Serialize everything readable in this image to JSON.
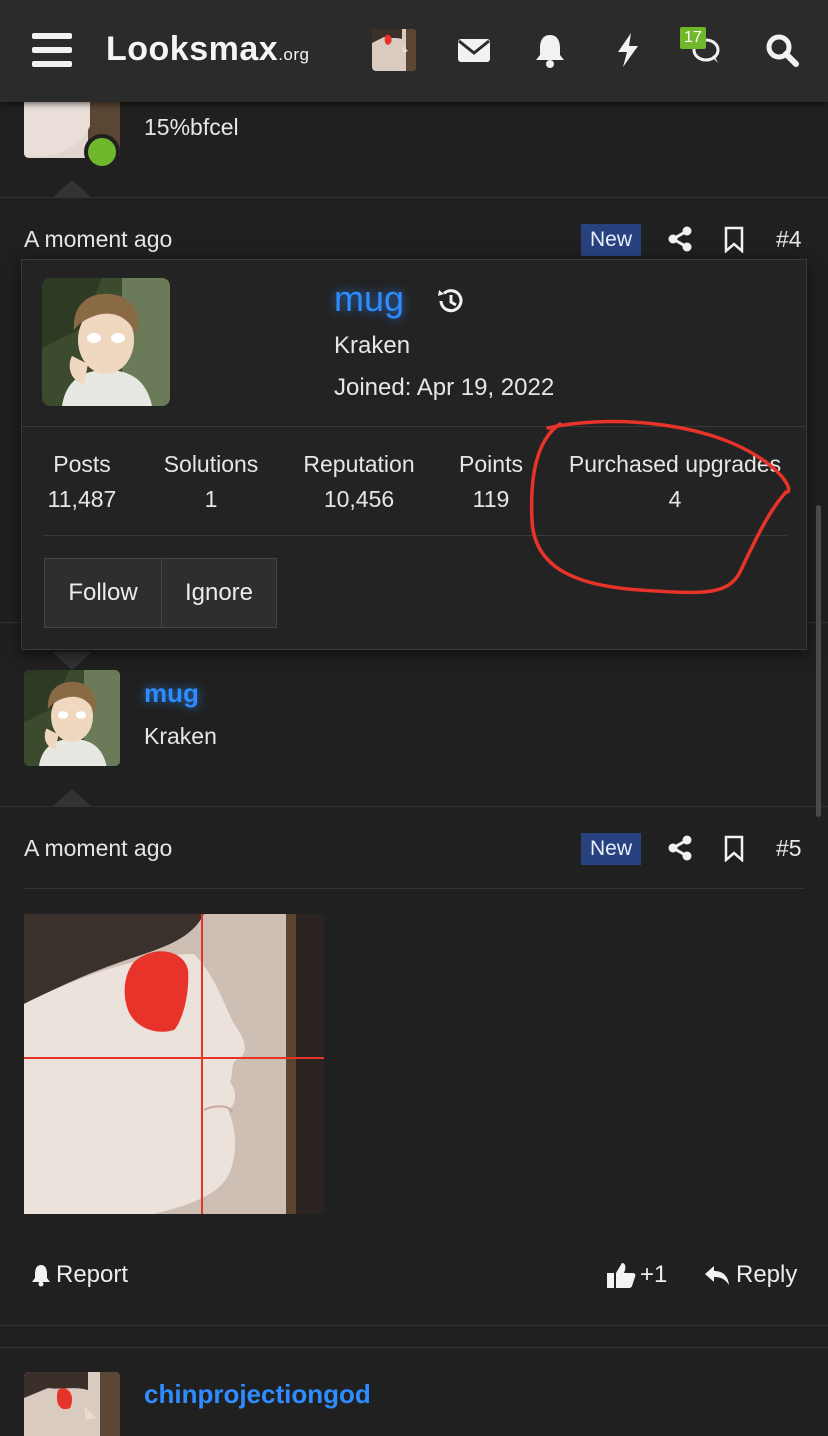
{
  "header": {
    "logo_main": "Looksmax",
    "logo_tld": ".org",
    "messages_count": "17"
  },
  "post_prev": {
    "user_title": "15%bfcel"
  },
  "post4": {
    "time": "A moment ago",
    "new_badge": "New",
    "number": "#4"
  },
  "member_card": {
    "username": "mug",
    "title": "Kraken",
    "joined": "Joined: Apr 19, 2022",
    "stats": [
      {
        "label": "Posts",
        "value": "11,487"
      },
      {
        "label": "Solutions",
        "value": "1"
      },
      {
        "label": "Reputation",
        "value": "10,456"
      },
      {
        "label": "Points",
        "value": "119"
      },
      {
        "label": "Purchased upgrades",
        "value": "4"
      }
    ],
    "follow_label": "Follow",
    "ignore_label": "Ignore"
  },
  "post5": {
    "username": "mug",
    "user_title": "Kraken",
    "time": "A moment ago",
    "new_badge": "New",
    "number": "#5",
    "report_label": "Report",
    "reaction_count": "+1",
    "reply_label": "Reply"
  },
  "post6": {
    "username": "chinprojectiongod"
  },
  "colors": {
    "accent": "#2f8cff",
    "new_badge_bg": "#27427f",
    "online": "#6fb82a",
    "annotation": "#e8332a"
  }
}
